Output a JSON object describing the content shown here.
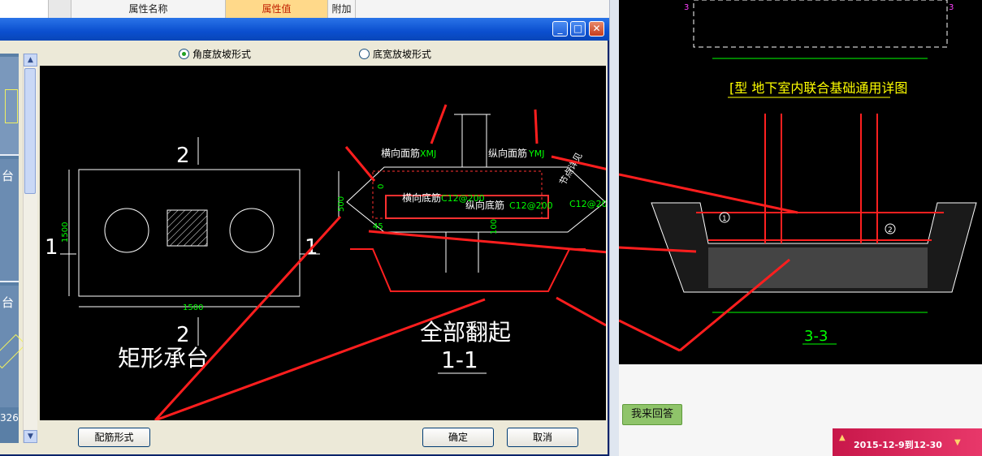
{
  "background_grid": {
    "col_name": "属性名称",
    "col_value": "属性值",
    "col_extra": "附加"
  },
  "dialog": {
    "radio_angle": "角度放坡形式",
    "radio_width": "底宽放坡形式",
    "btn_rebar": "配筋形式",
    "btn_ok": "确定",
    "btn_cancel": "取消",
    "left_hint_1": "台",
    "left_hint_2": "台",
    "left_hint_3": "326"
  },
  "drawing": {
    "sec_label_top": "2",
    "sec_label_bottom": "2",
    "sec_label_left": "1",
    "sec_label_right": "1",
    "dim_1500_v": "1500",
    "dim_1500_h": "1500",
    "shape_title": "矩形承台",
    "section_title": "全部翻起",
    "section_name": "1-1",
    "lbl_heng_mian": "横向面筋",
    "val_heng_mian": "XMJ",
    "lbl_zong_mian": "纵向面筋",
    "val_zong_mian": "YMJ",
    "lbl_heng_di": "横向底筋",
    "val_heng_di": "C12@200",
    "lbl_zong_di": "纵向底筋",
    "val_zong_di": "C12@200",
    "val_side": "C12@200",
    "dim_500": "500",
    "dim_100": "100",
    "dim_0": "0",
    "dim_45": "45",
    "side_note": "节点详见"
  },
  "right_panel": {
    "detail_title": "[型 地下室内联合基础通用详图",
    "section_33": "3-3",
    "mark_3a": "3",
    "mark_3b": "3",
    "circle_1": "1",
    "circle_2": "2",
    "answer_btn": "我来回答",
    "promo_text": "2015-12-9到12-30"
  },
  "colors": {
    "dimension_green": "#00ff00",
    "arrow_red": "#ff1e1e",
    "title_yellow": "#ffff00"
  }
}
